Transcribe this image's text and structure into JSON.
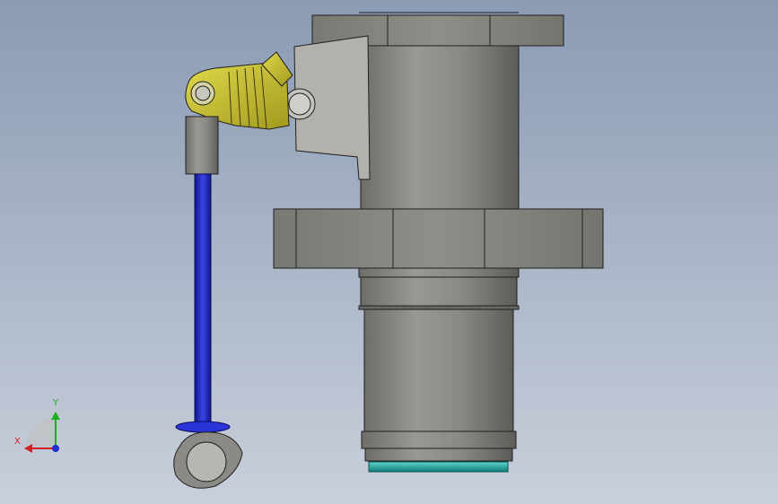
{
  "viewport": {
    "background_top": "#8a9bb4",
    "background_bottom": "#c9cfdb"
  },
  "colors": {
    "body_gray": "#8c8a84",
    "bracket_gray": "#b3b1ab",
    "lever_yellow": "#c9c232",
    "rod_blue": "#2028c8",
    "seal_teal": "#1aa7a4",
    "edge": "#1f1f1f"
  },
  "triad": {
    "x_label": "X",
    "y_label": "Y",
    "x_color": "#d21f1f",
    "y_color": "#19b21a",
    "z_color": "#1f2fd0"
  }
}
